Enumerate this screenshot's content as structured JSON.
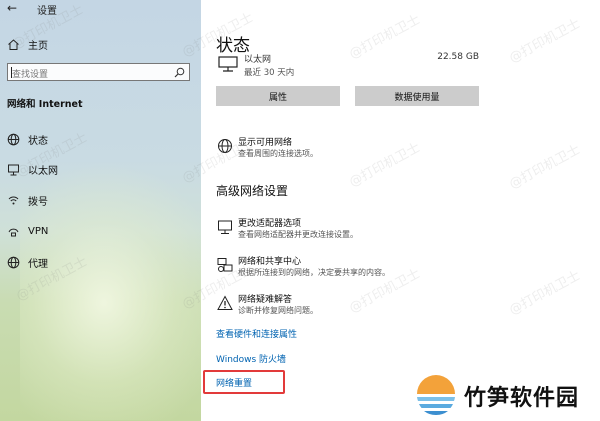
{
  "window": {
    "title": "设置"
  },
  "sidebar": {
    "home": "主页",
    "search_placeholder": "查找设置",
    "section": "网络和 Internet",
    "items": [
      {
        "label": "状态",
        "icon": "globe-icon"
      },
      {
        "label": "以太网",
        "icon": "ethernet-icon"
      },
      {
        "label": "拨号",
        "icon": "dialup-icon"
      },
      {
        "label": "VPN",
        "icon": "vpn-icon"
      },
      {
        "label": "代理",
        "icon": "globe-icon"
      }
    ]
  },
  "main": {
    "title": "状态",
    "ethernet": {
      "name": "以太网",
      "subtitle": "最近 30 天内",
      "usage": "22.58 GB"
    },
    "buttons": {
      "properties": "属性",
      "data_usage": "数据使用量"
    },
    "show_networks": {
      "title": "显示可用网络",
      "desc": "查看周围的连接选项。"
    },
    "advanced_heading": "高级网络设置",
    "advanced": [
      {
        "title": "更改适配器选项",
        "desc": "查看网络适配器并更改连接设置。",
        "icon": "adapter-icon"
      },
      {
        "title": "网络和共享中心",
        "desc": "根据所连接到的网络，决定要共享的内容。",
        "icon": "sharing-center-icon"
      },
      {
        "title": "网络疑难解答",
        "desc": "诊断并修复网络问题。",
        "icon": "warning-icon"
      }
    ],
    "links": {
      "hardware": "查看硬件和连接属性",
      "firewall": "Windows 防火墙",
      "reset": "网络重置"
    }
  },
  "watermark": "@打印机卫士",
  "brand": {
    "name": "竹笋软件园"
  },
  "colors": {
    "link": "#0063b1",
    "highlight_box": "#e23a3a",
    "button_bg": "#cccccc"
  }
}
